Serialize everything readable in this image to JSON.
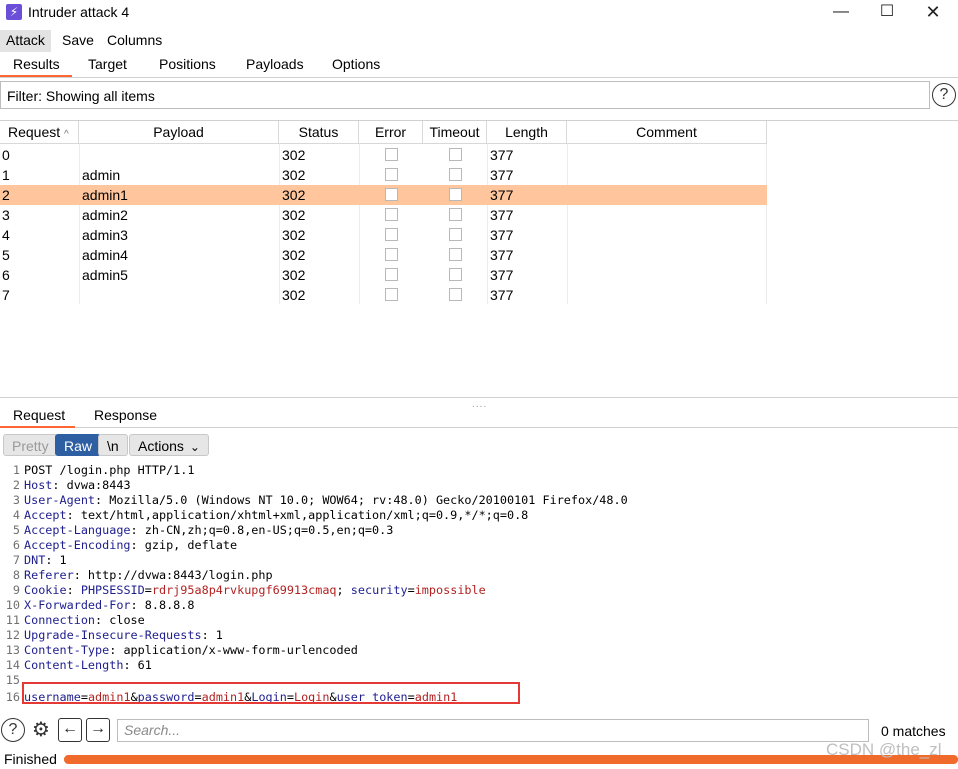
{
  "window": {
    "title": "Intruder attack 4",
    "minimize": "—",
    "maximize": "☐",
    "close": "✕"
  },
  "menu": [
    "Attack",
    "Save",
    "Columns"
  ],
  "top_tabs": [
    "Results",
    "Target",
    "Positions",
    "Payloads",
    "Options"
  ],
  "filter": {
    "text": "Filter: Showing all items"
  },
  "help_glyph": "?",
  "table": {
    "columns": [
      "Request",
      "Payload",
      "Status",
      "Error",
      "Timeout",
      "Length",
      "Comment"
    ],
    "sort_indicator": "^",
    "rows": [
      {
        "request": "0",
        "payload": "",
        "status": "302",
        "length": "377"
      },
      {
        "request": "1",
        "payload": "admin",
        "status": "302",
        "length": "377"
      },
      {
        "request": "2",
        "payload": "admin1",
        "status": "302",
        "length": "377"
      },
      {
        "request": "3",
        "payload": "admin2",
        "status": "302",
        "length": "377"
      },
      {
        "request": "4",
        "payload": "admin3",
        "status": "302",
        "length": "377"
      },
      {
        "request": "5",
        "payload": "admin4",
        "status": "302",
        "length": "377"
      },
      {
        "request": "6",
        "payload": "admin5",
        "status": "302",
        "length": "377"
      },
      {
        "request": "7",
        "payload": "",
        "status": "302",
        "length": "377"
      }
    ],
    "selected_row": 2,
    "selected_color": "#ffc59c"
  },
  "splitter": "....",
  "rr_tabs": [
    "Request",
    "Response"
  ],
  "toolbar": {
    "pretty": "Pretty",
    "raw": "Raw",
    "newline": "\\n",
    "actions": "Actions",
    "actions_chevron": "⌄"
  },
  "request_lines": [
    {
      "n": "1",
      "key": "",
      "value": "POST /login.php HTTP/1.1"
    },
    {
      "n": "2",
      "key": "Host",
      "value": " dvwa:8443"
    },
    {
      "n": "3",
      "key": "User-Agent",
      "value": " Mozilla/5.0 (Windows NT 10.0; WOW64; rv:48.0) Gecko/20100101 Firefox/48.0"
    },
    {
      "n": "4",
      "key": "Accept",
      "value": " text/html,application/xhtml+xml,application/xml;q=0.9,*/*;q=0.8"
    },
    {
      "n": "5",
      "key": "Accept-Language",
      "value": " zh-CN,zh;q=0.8,en-US;q=0.5,en;q=0.3"
    },
    {
      "n": "6",
      "key": "Accept-Encoding",
      "value": " gzip, deflate"
    },
    {
      "n": "7",
      "key": "DNT",
      "value": " 1"
    },
    {
      "n": "8",
      "key": "Referer",
      "value": " http://dvwa:8443/login.php"
    },
    {
      "n": "10",
      "key": "X-Forwarded-For",
      "value": " 8.8.8.8"
    },
    {
      "n": "11",
      "key": "Connection",
      "value": " close"
    },
    {
      "n": "12",
      "key": "Upgrade-Insecure-Requests",
      "value": " 1"
    },
    {
      "n": "13",
      "key": "Content-Type",
      "value": " application/x-www-form-urlencoded"
    },
    {
      "n": "14",
      "key": "Content-Length",
      "value": " 61"
    },
    {
      "n": "15",
      "key": "",
      "value": ""
    }
  ],
  "cookie_line": {
    "n": "9",
    "key": "Cookie",
    "name1": "PHPSESSID",
    "value1": "rdrj95a8p4rvkupgf69913cmaq",
    "sep": ";",
    "name2": "security",
    "value2": "impossible"
  },
  "body_line": {
    "n": "16",
    "k1": "username",
    "v1": "admin1",
    "k2": "password",
    "v2": "admin1",
    "k3": "Login",
    "v3": "Login",
    "k4": "user_token",
    "v4": "admin1"
  },
  "search": {
    "placeholder": "Search...",
    "matches": "0 matches",
    "gear": "⚙",
    "back": "←",
    "forward": "→"
  },
  "status": {
    "text": "Finished",
    "progress": 1.0
  },
  "watermark": "CSDN @the_zl",
  "colors": {
    "accent": "#ff6633",
    "raw_button": "#2e5fa3",
    "progress": "#f06a2c",
    "highlight_box": "#e53935"
  }
}
